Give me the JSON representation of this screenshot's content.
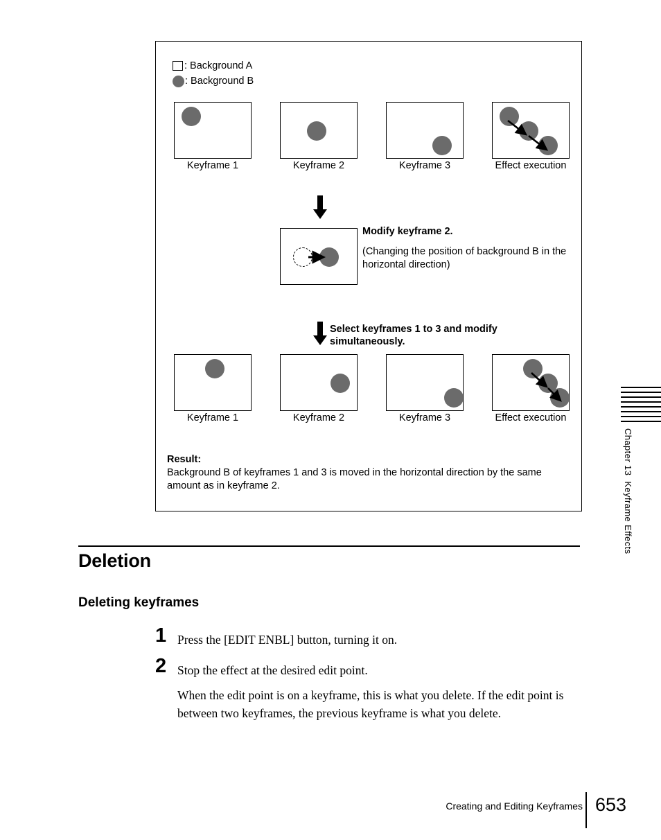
{
  "figure": {
    "legend": [
      {
        "icon": "square-swatch",
        "label": ": Background A"
      },
      {
        "icon": "circle-swatch",
        "label": ": Background B"
      }
    ],
    "row1": {
      "frames": [
        {
          "caption": "Keyframe 1"
        },
        {
          "caption": "Keyframe 2"
        },
        {
          "caption": "Keyframe 3"
        },
        {
          "caption": "Effect execution"
        }
      ]
    },
    "modify": {
      "arrow": "down-arrow",
      "title": "Modify keyframe 2.",
      "body": "(Changing the position of background B in the horizontal direction)"
    },
    "select": {
      "arrow": "down-arrow",
      "line1": "Select keyframes 1 to 3 and modify",
      "line2": "simultaneously."
    },
    "row2": {
      "frames": [
        {
          "caption": "Keyframe 1"
        },
        {
          "caption": "Keyframe 2"
        },
        {
          "caption": "Keyframe 3"
        },
        {
          "caption": "Effect execution"
        }
      ]
    },
    "result": {
      "title": "Result:",
      "body": "Background B of keyframes 1 and 3 is moved in the horizontal direction by the same amount as in keyframe 2."
    },
    "colors": {
      "dot_fill": "#6b6b6b",
      "stroke": "#000000"
    }
  },
  "content": {
    "section_heading": "Deletion",
    "sub_heading": "Deleting keyframes",
    "steps": [
      {
        "number": "1",
        "text": "Press the [EDIT ENBL] button, turning it on."
      },
      {
        "number": "2",
        "text": "Stop the effect at the desired edit point."
      }
    ],
    "paragraph": "When the edit point is on a keyframe, this is what you delete. If the edit point is between two keyframes, the previous keyframe is what you delete."
  },
  "side_tab": {
    "text": "Chapter 13  Keyframe Effects"
  },
  "footer": {
    "running_head": "Creating and Editing Keyframes",
    "page_number": "653"
  }
}
